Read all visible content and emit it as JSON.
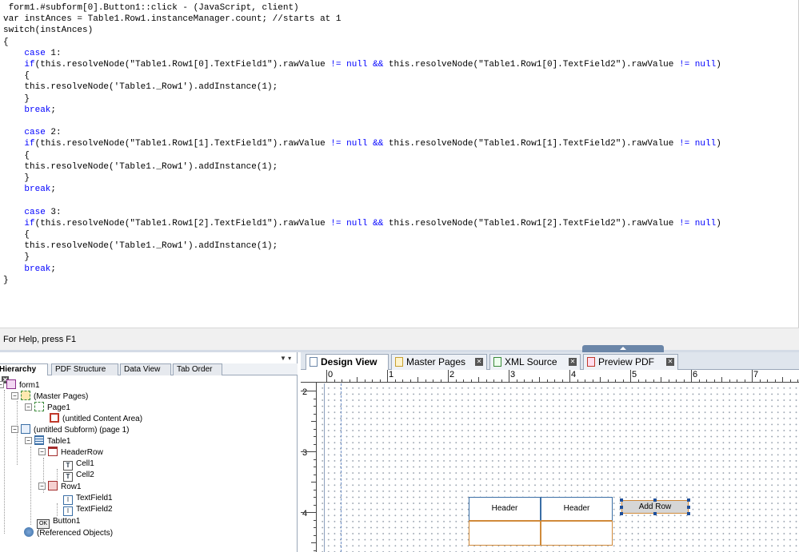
{
  "editor": {
    "lines": [
      " form1.#subform[0].Button1::click - (JavaScript, client)",
      "var instAnces = Table1.Row1.instanceManager.count; //starts at 1",
      "switch(instAnces)",
      "{",
      "    case 1:",
      "    if(this.resolveNode(\"Table1.Row1[0].TextField1\").rawValue != null && this.resolveNode(\"Table1.Row1[0].TextField2\").rawValue != null)",
      "    {",
      "    this.resolveNode('Table1._Row1').addInstance(1);",
      "    }",
      "    break;",
      "",
      "    case 2:",
      "    if(this.resolveNode(\"Table1.Row1[1].TextField1\").rawValue != null && this.resolveNode(\"Table1.Row1[1].TextField2\").rawValue != null)",
      "    {",
      "    this.resolveNode('Table1._Row1').addInstance(1);",
      "    }",
      "    break;",
      "",
      "    case 3:",
      "    if(this.resolveNode(\"Table1.Row1[2].TextField1\").rawValue != null && this.resolveNode(\"Table1.Row1[2].TextField2\").rawValue != null)",
      "    {",
      "    this.resolveNode('Table1._Row1').addInstance(1);",
      "    }",
      "    break;",
      "}"
    ],
    "keyword_color": "#0000ff"
  },
  "status": {
    "text": "For Help, press F1"
  },
  "palette": {
    "tabs": [
      "Hierarchy",
      "PDF Structure",
      "Data View",
      "Tab Order"
    ],
    "tree": [
      {
        "label": "form1",
        "icon": "form-icon"
      },
      {
        "label": "(Master Pages)",
        "icon": "master-pages-icon"
      },
      {
        "label": "Page1",
        "icon": "page-icon"
      },
      {
        "label": "(untitled Content Area)",
        "icon": "content-area-icon"
      },
      {
        "label": "(untitled Subform) (page 1)",
        "icon": "subform-icon"
      },
      {
        "label": "Table1",
        "icon": "table-icon"
      },
      {
        "label": "HeaderRow",
        "icon": "header-row-icon"
      },
      {
        "label": "Cell1",
        "icon": "text-cell-icon"
      },
      {
        "label": "Cell2",
        "icon": "text-cell-icon"
      },
      {
        "label": "Row1",
        "icon": "row-icon"
      },
      {
        "label": "TextField1",
        "icon": "text-field-icon"
      },
      {
        "label": "TextField2",
        "icon": "text-field-icon"
      },
      {
        "label": "Button1",
        "icon": "button-icon"
      },
      {
        "label": "(Referenced Objects)",
        "icon": "referenced-objects-icon"
      }
    ],
    "icon_glyphs": {
      "cell": "T",
      "field": "I",
      "button": "OK"
    }
  },
  "design": {
    "tabs": [
      "Design View",
      "Master Pages",
      "XML Source",
      "Preview PDF"
    ],
    "ruler_top": [
      "0",
      "1",
      "2",
      "3",
      "4",
      "5",
      "6",
      "7"
    ],
    "ruler_left": [
      "2",
      "3",
      "4"
    ],
    "table_headers": [
      "Header",
      "Header"
    ],
    "button_label": "Add Row"
  }
}
